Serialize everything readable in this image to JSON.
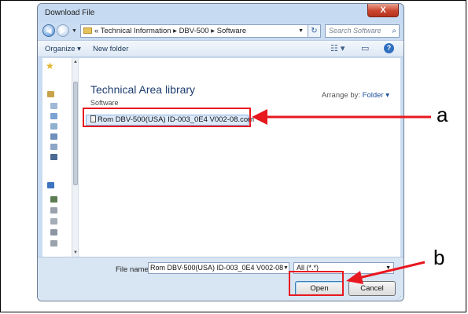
{
  "dialog": {
    "title": "Download File",
    "close_glyph": "X"
  },
  "address": {
    "back_glyph": "◀",
    "forward_glyph": "▶",
    "breadcrumb": "« Technical Information ▸ DBV-500 ▸ Software",
    "search_placeholder": "Search Software",
    "refresh_glyph": "↻",
    "search_glyph": "⌕"
  },
  "toolbar": {
    "organize_label": "Organize ▾",
    "new_folder_label": "New folder",
    "views_glyph": "☷ ▾",
    "preview_glyph": "▭",
    "help_glyph": "?"
  },
  "content": {
    "library_title": "Technical Area library",
    "library_subtitle": "Software",
    "arrange_label": "Arrange by:",
    "arrange_value": "Folder ▾",
    "files": [
      {
        "name": "Rom DBV-500(USA) ID-003_0E4 V002-08.com"
      }
    ]
  },
  "footer": {
    "file_name_label": "File name:",
    "file_name_value": "Rom DBV-500(USA) ID-003_0E4 V002-08",
    "filter_value": "All (*.*)",
    "open_label": "Open",
    "cancel_label": "Cancel"
  },
  "callouts": {
    "a": "a",
    "b": "b"
  },
  "colors": {
    "highlight": "#e8181f",
    "selection": "#dceafb",
    "title_bar": "#c6daf1"
  }
}
